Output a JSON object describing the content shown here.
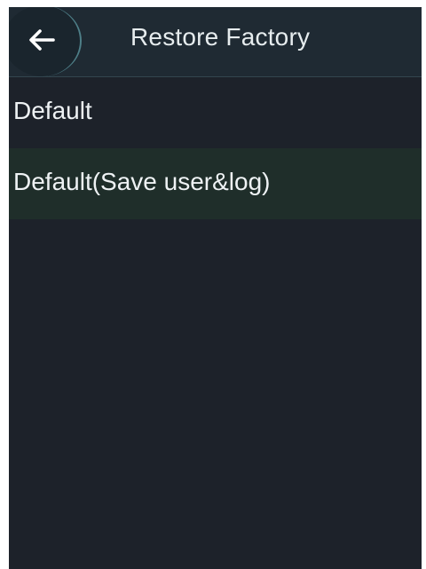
{
  "header": {
    "title": "Restore Factory",
    "back_icon": "arrow-left-icon"
  },
  "menu": {
    "items": [
      {
        "label": "Default",
        "selected": false
      },
      {
        "label": "Default(Save user&log)",
        "selected": true
      }
    ]
  },
  "colors": {
    "background": "#1d222a",
    "header_background": "#1f2a33",
    "selected_row": "#1f2e2a",
    "back_button_accent": "#4e7f88",
    "text": "#eef2f4"
  }
}
